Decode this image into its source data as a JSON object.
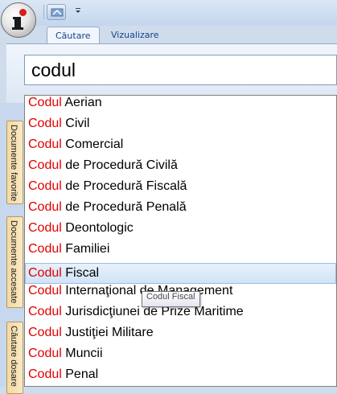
{
  "window": {
    "tabs": [
      {
        "label": "Căutare",
        "active": true
      },
      {
        "label": "Vizualizare",
        "active": false
      }
    ]
  },
  "search": {
    "value": "codul"
  },
  "side_tabs": [
    {
      "label": "Documente favorite"
    },
    {
      "label": "Documente accesate"
    },
    {
      "label": "Căutare dosare"
    }
  ],
  "suggestions": [
    {
      "match": "Codul",
      "rest": " Aerian"
    },
    {
      "match": "Codul",
      "rest": " Civil"
    },
    {
      "match": "Codul",
      "rest": " Comercial"
    },
    {
      "match": "Codul",
      "rest": " de Procedură Civilă"
    },
    {
      "match": "Codul",
      "rest": " de Procedură Fiscală"
    },
    {
      "match": "Codul",
      "rest": " de Procedură Penală"
    },
    {
      "match": "Codul",
      "rest": " Deontologic"
    },
    {
      "match": "Codul",
      "rest": " Familiei"
    },
    {
      "match": "Codul",
      "rest": " Fiscal",
      "hover": true
    },
    {
      "match": "Codul",
      "rest": " Internaţional de Management"
    },
    {
      "match": "Codul",
      "rest": " Jurisdicţiunei de Prize Maritime"
    },
    {
      "match": "Codul",
      "rest": " Justiţiei Militare"
    },
    {
      "match": "Codul",
      "rest": " Muncii"
    },
    {
      "match": "Codul",
      "rest": " Penal"
    }
  ],
  "tooltip": {
    "text": "Codul Fiscal"
  },
  "colors": {
    "highlight": "#e00000",
    "ribbon_text": "#15428b"
  }
}
